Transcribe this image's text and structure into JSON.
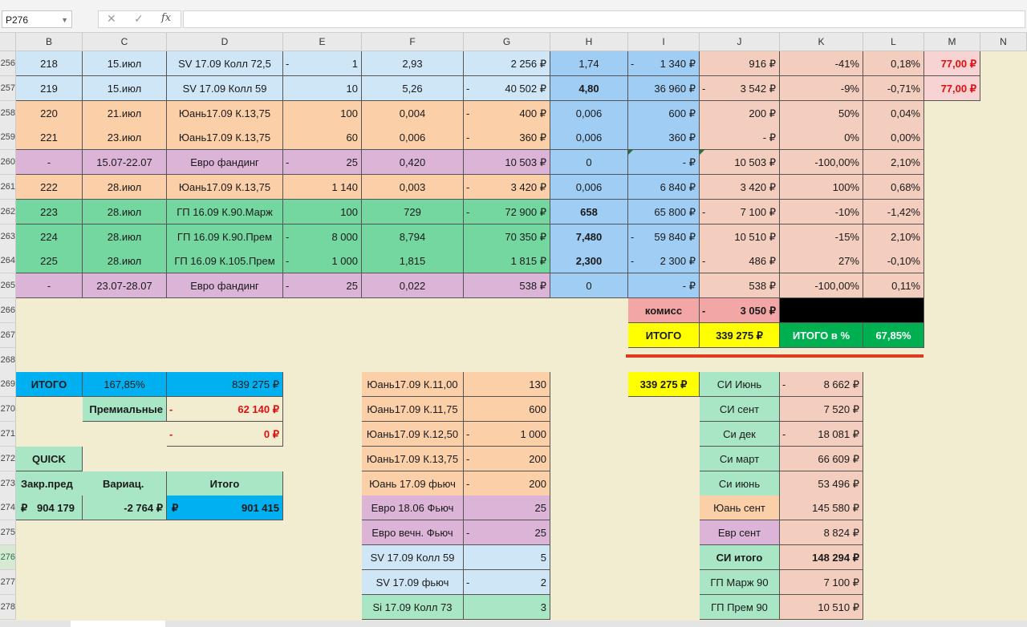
{
  "toolbar": {
    "name_box": "P276",
    "cancel_icon": "✕",
    "enter_icon": "✓",
    "fx_label": "fx",
    "formula": ""
  },
  "columns": [
    "B",
    "C",
    "D",
    "E",
    "F",
    "G",
    "H",
    "I",
    "J",
    "K",
    "L",
    "M",
    "N"
  ],
  "row_numbers": [
    "256",
    "257",
    "258",
    "259",
    "260",
    "261",
    "262",
    "263",
    "264",
    "265",
    "266",
    "267",
    "268",
    "269",
    "270",
    "271",
    "272",
    "273",
    "274",
    "275",
    "276",
    "277",
    "278"
  ],
  "selected_row": "276",
  "trades": [
    {
      "b": "218",
      "c": "15.июл",
      "d": "SV 17.09 Колл 72,5",
      "e": "1",
      "e_neg": true,
      "f": "2,93",
      "g": "2 256 ₽",
      "h": "1,74",
      "i": "1 340 ₽",
      "i_neg": true,
      "j": "916 ₽",
      "k": "-41%",
      "l": "0,18%",
      "m": "77,00 ₽"
    },
    {
      "b": "219",
      "c": "15.июл",
      "d": "SV 17.09 Колл 59",
      "e": "10",
      "f": "5,26",
      "g": "40 502 ₽",
      "g_neg": true,
      "h": "4,80",
      "h_bold": true,
      "i": "36 960 ₽",
      "j": "3 542 ₽",
      "j_neg": true,
      "k": "-9%",
      "l": "-0,71%",
      "m": "77,00 ₽"
    },
    {
      "b": "220",
      "c": "21.июл",
      "d": "Юань17.09 К.13,75",
      "e": "100",
      "f": "0,004",
      "g": "400 ₽",
      "g_neg": true,
      "h": "0,006",
      "i": "600 ₽",
      "j": "200 ₽",
      "k": "50%",
      "l": "0,04%"
    },
    {
      "b": "221",
      "c": "23.июл",
      "d": "Юань17.09 К.13,75",
      "e": "60",
      "f": "0,006",
      "g": "360 ₽",
      "g_neg": true,
      "h": "0,006",
      "i": "360 ₽",
      "j": "-   ₽",
      "k": "0%",
      "l": "0,00%"
    },
    {
      "b": "-",
      "c": "15.07-22.07",
      "d": "Евро фандинг",
      "e": "25",
      "e_neg": true,
      "f": "0,420",
      "g": "10 503 ₽",
      "h": "0",
      "i": "-   ₽",
      "j": "10 503 ₽",
      "k": "-100,00%",
      "l": "2,10%"
    },
    {
      "b": "222",
      "c": "28.июл",
      "d": "Юань17.09 К.13,75",
      "e": "1 140",
      "f": "0,003",
      "g": "3 420 ₽",
      "g_neg": true,
      "h": "0,006",
      "i": "6 840 ₽",
      "j": "3 420 ₽",
      "k": "100%",
      "l": "0,68%"
    },
    {
      "b": "223",
      "c": "28.июл",
      "d": "ГП 16.09 К.90.Марж",
      "e": "100",
      "f": "729",
      "g": "72 900 ₽",
      "g_neg": true,
      "h": "658",
      "h_bold": true,
      "i": "65 800 ₽",
      "j": "7 100 ₽",
      "j_neg": true,
      "k": "-10%",
      "l": "-1,42%"
    },
    {
      "b": "224",
      "c": "28.июл",
      "d": "ГП 16.09 К.90.Прем",
      "e": "8 000",
      "e_neg": true,
      "f": "8,794",
      "g": "70 350 ₽",
      "h": "7,480",
      "h_bold": true,
      "i": "59 840 ₽",
      "i_neg": true,
      "j": "10 510 ₽",
      "k": "-15%",
      "l": "2,10%"
    },
    {
      "b": "225",
      "c": "28.июл",
      "d": "ГП 16.09 К.105.Прем",
      "e": "1 000",
      "e_neg": true,
      "f": "1,815",
      "g": "1 815 ₽",
      "h": "2,300",
      "h_bold": true,
      "i": "2 300 ₽",
      "i_neg": true,
      "j": "486 ₽",
      "j_neg": true,
      "k": "27%",
      "l": "-0,10%"
    },
    {
      "b": "-",
      "c": "23.07-28.07",
      "d": "Евро фандинг",
      "e": "25",
      "e_neg": true,
      "f": "0,022",
      "g": "538 ₽",
      "h": "0",
      "i": "-   ₽",
      "j": "538 ₽",
      "k": "-100,00%",
      "l": "0,11%"
    }
  ],
  "totals": {
    "komiss_label": "комисс",
    "komiss_value": "3 050 ₽",
    "itogo_label": "ИТОГО",
    "itogo_value": "339 275 ₽",
    "itogo_pct_label": "ИТОГО в %",
    "itogo_pct_value": "67,85%"
  },
  "left_block": {
    "itogo_label": "ИТОГО",
    "itogo_pct": "167,85%",
    "itogo_sum": "839 275 ₽",
    "premium_label": "Премиальные",
    "premium_value": "62 140 ₽",
    "zero_value": "0 ₽",
    "quick_label": "QUICK",
    "closed_label": "Закр.пред",
    "variation_label": "Вариац.",
    "total_label": "Итого",
    "closed_currency": "₽",
    "closed_value": "904 179",
    "variation_value": "-2 764 ₽",
    "total_currency": "₽",
    "total_value": "901 415"
  },
  "positions": [
    {
      "name": "Юань17.09 К.11,00",
      "qty": "130",
      "neg": false,
      "color": "or"
    },
    {
      "name": "Юань17.09 К.11,75",
      "qty": "600",
      "neg": false,
      "color": "or"
    },
    {
      "name": "Юань17.09 К.12,50",
      "qty": "1 000",
      "neg": true,
      "color": "or"
    },
    {
      "name": "Юань17.09 К.13,75",
      "qty": "200",
      "neg": true,
      "color": "or"
    },
    {
      "name": "Юань 17.09 фьюч",
      "qty": "200",
      "neg": true,
      "color": "or"
    },
    {
      "name": "Евро 18.06 Фьюч",
      "qty": "25",
      "neg": false,
      "color": "pu"
    },
    {
      "name": "Евро вечн. Фьюч",
      "qty": "25",
      "neg": true,
      "color": "pu"
    },
    {
      "name": "SV 17.09 Колл 59",
      "qty": "5",
      "neg": false,
      "color": "lb"
    },
    {
      "name": "SV 17.09 фьюч",
      "qty": "2",
      "neg": true,
      "color": "lb"
    },
    {
      "name": "Si 17.09 Колл 73",
      "qty": "3",
      "neg": false,
      "color": "lg"
    }
  ],
  "right_block": {
    "total_value": "339 275 ₽",
    "items": [
      {
        "name": "СИ Июнь",
        "value": "8 662 ₽",
        "neg": true,
        "color": "lg",
        "bold": false
      },
      {
        "name": "СИ сент",
        "value": "7 520 ₽",
        "neg": false,
        "color": "lg",
        "bold": false
      },
      {
        "name": "Си дек",
        "value": "18 081 ₽",
        "neg": true,
        "color": "lg",
        "bold": false
      },
      {
        "name": "Си март",
        "value": "66 609 ₽",
        "neg": false,
        "color": "lg",
        "bold": false
      },
      {
        "name": "Си июнь",
        "value": "53 496 ₽",
        "neg": false,
        "color": "lg",
        "bold": false
      },
      {
        "name": "Юань сент",
        "value": "145 580 ₽",
        "neg": false,
        "color": "or",
        "bold": false
      },
      {
        "name": "Евр сент",
        "value": "8 824 ₽",
        "neg": false,
        "color": "pu",
        "bold": false
      },
      {
        "name": "СИ итого",
        "value": "148 294 ₽",
        "neg": false,
        "color": "lg",
        "bold": true
      },
      {
        "name": "ГП Марж 90",
        "value": "7 100 ₽",
        "neg": false,
        "color": "lg",
        "bold": false
      },
      {
        "name": "ГП Прем 90",
        "value": "10 510 ₽",
        "neg": false,
        "color": "lg",
        "bold": false
      }
    ]
  }
}
